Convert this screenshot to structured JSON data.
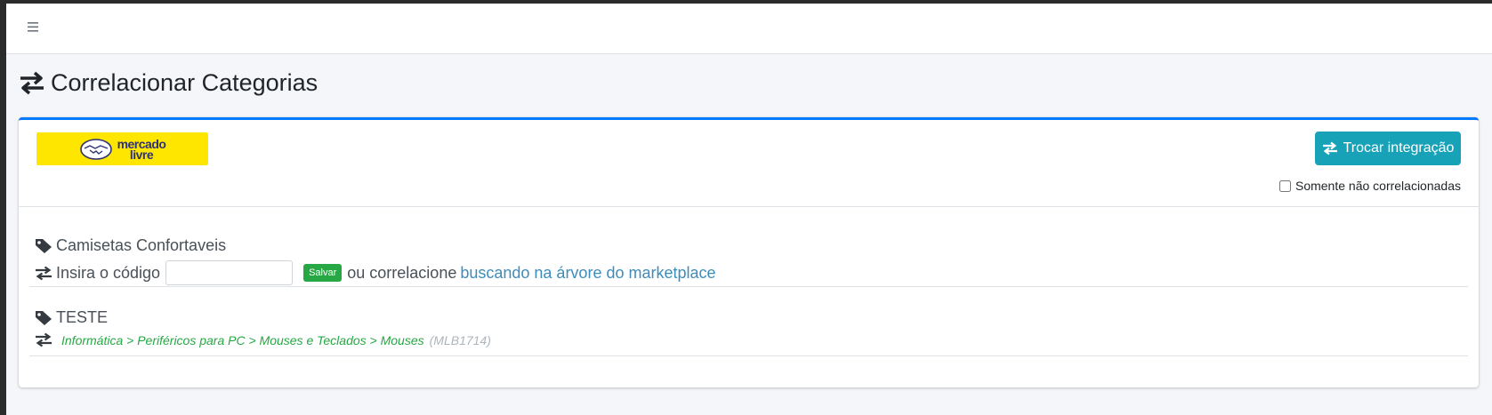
{
  "page": {
    "title": "Correlacionar Categorias"
  },
  "header": {
    "logo_line1": "mercado",
    "logo_line2": "livre",
    "switch_button_label": "Trocar integração",
    "only_uncorrelated_label": "Somente não correlacionadas"
  },
  "items": [
    {
      "name": "Camisetas Confortaveis",
      "code_prompt": "Insira o código",
      "code_value": "",
      "save_label": "Salvar",
      "or_text": "ou correlacione",
      "tree_link": "buscando na árvore do marketplace"
    },
    {
      "name": "TESTE",
      "category_path": "Informática > Periféricos para PC > Mouses e Teclados > Mouses",
      "category_code": "(MLB1714)"
    }
  ],
  "colors": {
    "accent": "#007bff",
    "switch_button": "#17a2b8",
    "save_button": "#28a745",
    "link": "#3c8dbc",
    "logo_bg": "#ffe600"
  },
  "icons": {
    "menu": "bars-icon",
    "exchange": "exchange-icon",
    "tag": "tag-icon",
    "logo": "handshake-icon"
  }
}
